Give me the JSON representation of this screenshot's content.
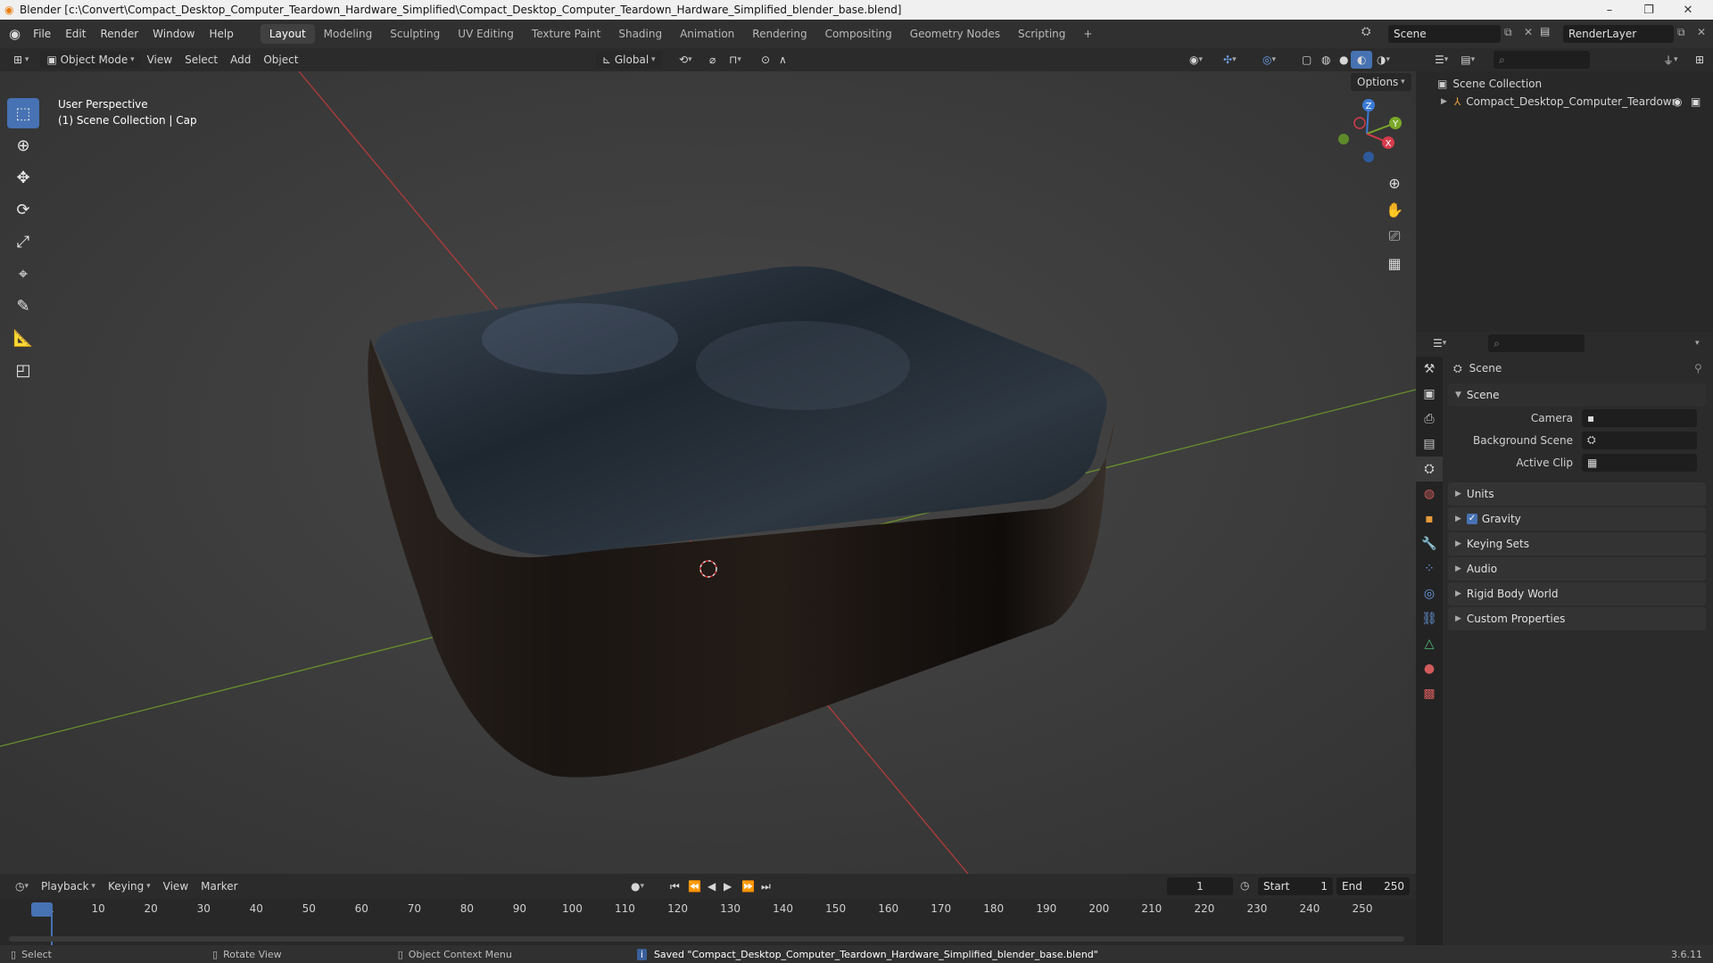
{
  "window": {
    "title": "Blender [c:\\Convert\\Compact_Desktop_Computer_Teardown_Hardware_Simplified\\Compact_Desktop_Computer_Teardown_Hardware_Simplified_blender_base.blend]",
    "minimize": "–",
    "maximize": "❐",
    "close": "✕"
  },
  "menu": [
    "File",
    "Edit",
    "Render",
    "Window",
    "Help"
  ],
  "workspaces": [
    "Layout",
    "Modeling",
    "Sculpting",
    "UV Editing",
    "Texture Paint",
    "Shading",
    "Animation",
    "Rendering",
    "Compositing",
    "Geometry Nodes",
    "Scripting",
    "+"
  ],
  "active_workspace": "Layout",
  "scene_field": "Scene",
  "renderlayer_field": "RenderLayer",
  "viewport_header": {
    "mode": "Object Mode",
    "menus": [
      "View",
      "Select",
      "Add",
      "Object"
    ],
    "orientation": "Global",
    "options": "Options"
  },
  "viewport": {
    "line1": "User Perspective",
    "line2": "(1) Scene Collection | Cap",
    "gizmo": {
      "z": "Z",
      "y": "Y",
      "x": "X"
    }
  },
  "outliner": {
    "collection": "Scene Collection",
    "item": "Compact_Desktop_Computer_Teardowr"
  },
  "properties": {
    "header": "Scene",
    "section": "Scene",
    "fields": [
      {
        "label": "Camera",
        "value": ""
      },
      {
        "label": "Background Scene",
        "value": ""
      },
      {
        "label": "Active Clip",
        "value": ""
      }
    ],
    "panels": [
      "Units",
      "Gravity",
      "Keying Sets",
      "Audio",
      "Rigid Body World",
      "Custom Properties"
    ],
    "gravity_checked": true
  },
  "timeline": {
    "menus": [
      "Playback",
      "Keying",
      "View",
      "Marker"
    ],
    "current_frame": "1",
    "start_label": "Start",
    "start": "1",
    "end_label": "End",
    "end": "250",
    "ticks": [
      "1",
      "10",
      "20",
      "30",
      "40",
      "50",
      "60",
      "70",
      "80",
      "90",
      "100",
      "110",
      "120",
      "130",
      "140",
      "150",
      "160",
      "170",
      "180",
      "190",
      "200",
      "210",
      "220",
      "230",
      "240",
      "250"
    ]
  },
  "status": {
    "select": "Select",
    "rotate": "Rotate View",
    "context": "Object Context Menu",
    "message": "Saved \"Compact_Desktop_Computer_Teardown_Hardware_Simplified_blender_base.blend\"",
    "version": "3.6.11"
  }
}
